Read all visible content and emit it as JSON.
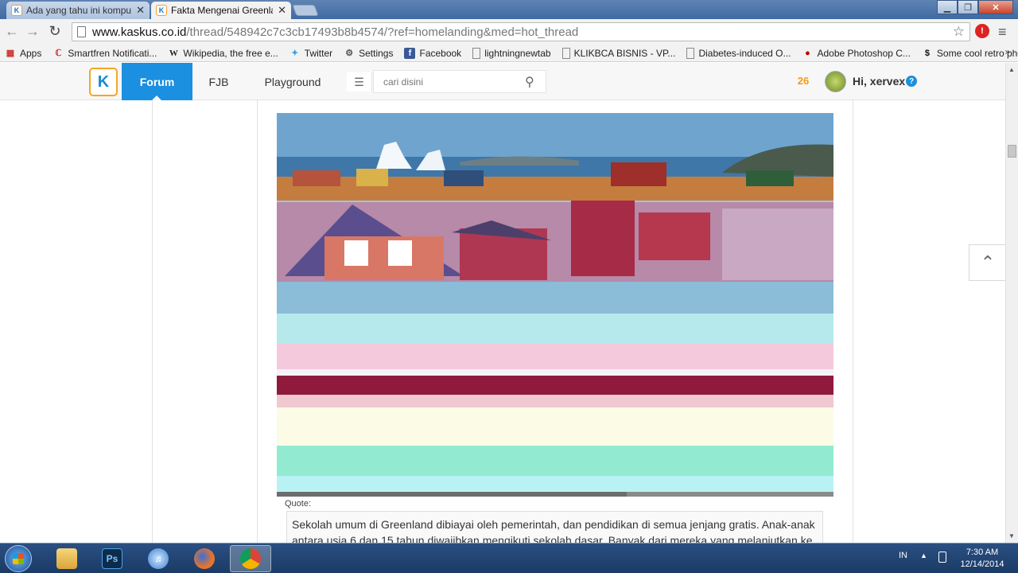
{
  "browser": {
    "tabs": [
      {
        "title": "Ada yang tahu ini komput",
        "active": false
      },
      {
        "title": "Fakta Mengenai Greenland",
        "active": true
      }
    ],
    "url_host": "www.kaskus.co.id",
    "url_path": "/thread/548942c7c3cb17493b8b4574/?ref=homelanding&med=hot_thread",
    "bookmarks": [
      {
        "label": "Apps",
        "icon": "apps-grid-icon"
      },
      {
        "label": "Smartfren Notificati...",
        "icon": "smartfren-icon"
      },
      {
        "label": "Wikipedia, the free e...",
        "icon": "wikipedia-icon"
      },
      {
        "label": "Twitter",
        "icon": "twitter-icon"
      },
      {
        "label": "Settings",
        "icon": "gear-icon"
      },
      {
        "label": "Facebook",
        "icon": "facebook-icon"
      },
      {
        "label": "lightningnewtab",
        "icon": "page-icon"
      },
      {
        "label": "KLIKBCA BISNIS - VP...",
        "icon": "page-icon"
      },
      {
        "label": "Diabetes-induced O...",
        "icon": "page-icon"
      },
      {
        "label": "Adobe Photoshop C...",
        "icon": "adobe-icon"
      },
      {
        "label": "Some cool retro pho...",
        "icon": "retro-icon"
      }
    ],
    "bookmarks_more": "»"
  },
  "kaskus": {
    "logo_text": "K",
    "nav": {
      "forum": "Forum",
      "fjb": "FJB",
      "playground": "Playground"
    },
    "search_placeholder": "cari disini",
    "notif_count": "26",
    "greeting": "Hi, xervex",
    "help": "?"
  },
  "post": {
    "quote_label": "Quote:",
    "quote_text": "Sekolah umum di Greenland dibiayai oleh pemerintah, dan pendidikan di semua jenjang gratis. Anak-anak antara usia 6 dan 15 tahun diwajibkan mengikuti sekolah dasar. Banyak dari mereka yang melanjutkan ke"
  },
  "taskbar": {
    "apps": [
      {
        "name": "explorer",
        "label": "",
        "active": false
      },
      {
        "name": "photoshop",
        "label": "Ps",
        "active": false
      },
      {
        "name": "itunes",
        "label": "♫",
        "active": false
      },
      {
        "name": "firefox",
        "label": "",
        "active": false
      },
      {
        "name": "chrome",
        "label": "",
        "active": true
      }
    ],
    "lang": "IN",
    "time": "7:30 AM",
    "date": "12/14/2014"
  },
  "colors": {
    "kaskus_blue": "#1b8fe0",
    "kaskus_orange": "#f5a623"
  }
}
